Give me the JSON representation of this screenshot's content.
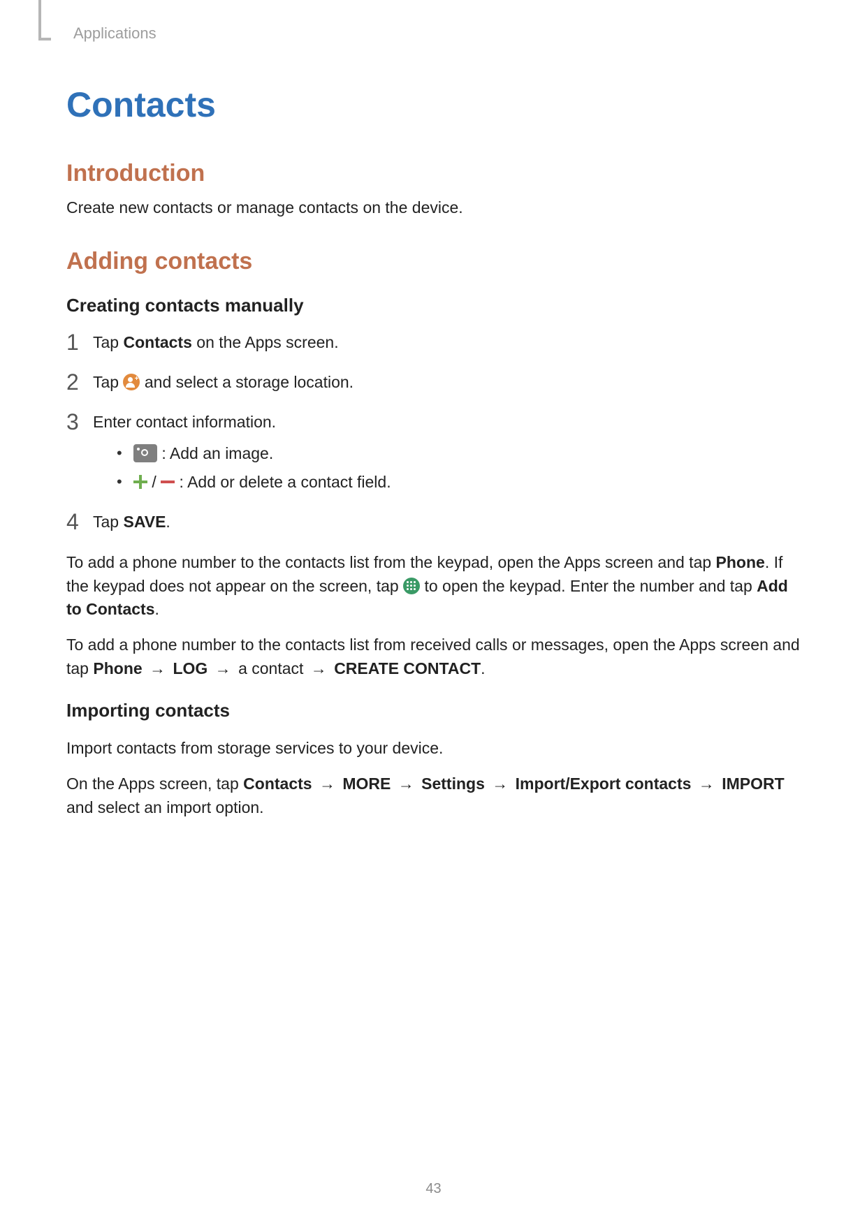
{
  "breadcrumb": "Applications",
  "title": "Contacts",
  "page_number": "43",
  "section_intro": {
    "heading": "Introduction",
    "text": "Create new contacts or manage contacts on the device."
  },
  "section_adding": {
    "heading": "Adding contacts",
    "sub_creating": {
      "heading": "Creating contacts manually",
      "steps": {
        "s1": {
          "num": "1",
          "pre": "Tap ",
          "bold": "Contacts",
          "post": " on the Apps screen."
        },
        "s2": {
          "num": "2",
          "pre": "Tap ",
          "post": " and select a storage location."
        },
        "s3": {
          "num": "3",
          "text": "Enter contact information.",
          "bullet_camera": " : Add an image.",
          "bullet_pm_mid": " / ",
          "bullet_pm_post": " : Add or delete a contact field."
        },
        "s4": {
          "num": "4",
          "pre": "Tap ",
          "bold": "SAVE",
          "post": "."
        }
      },
      "para1": {
        "t1": "To add a phone number to the contacts list from the keypad, open the Apps screen and tap ",
        "b1": "Phone",
        "t2": ". If the keypad does not appear on the screen, tap ",
        "t3": " to open the keypad. Enter the number and tap ",
        "b2": "Add to Contacts",
        "t4": "."
      },
      "para2": {
        "t1": "To add a phone number to the contacts list from received calls or messages, open the Apps screen and tap ",
        "b1": "Phone",
        "arrow": " → ",
        "b2": "LOG",
        "t2": " a contact ",
        "b3": "CREATE CONTACT",
        "t3": "."
      }
    },
    "sub_importing": {
      "heading": "Importing contacts",
      "lead": "Import contacts from storage services to your device.",
      "para": {
        "t1": "On the Apps screen, tap ",
        "b1": "Contacts",
        "arrow": " → ",
        "b2": "MORE",
        "b3": "Settings",
        "b4": "Import/Export contacts",
        "b5": "IMPORT",
        "t2": " and select an import option."
      }
    }
  }
}
